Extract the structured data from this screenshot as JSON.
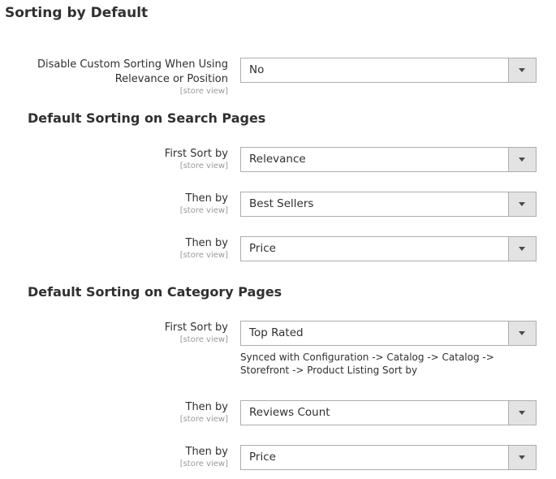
{
  "page_title": "Sorting by Default",
  "scope_label": "[store view]",
  "general": {
    "disable_custom_sorting": {
      "label": "Disable Custom Sorting When Using Relevance or Position",
      "label_line1": "Disable Custom Sorting When Using",
      "label_line2": "Relevance or Position",
      "value": "No"
    }
  },
  "search_pages": {
    "title": "Default Sorting on Search Pages",
    "fields": [
      {
        "label": "First Sort by",
        "value": "Relevance"
      },
      {
        "label": "Then by",
        "value": "Best Sellers"
      },
      {
        "label": "Then by",
        "value": "Price"
      }
    ]
  },
  "category_pages": {
    "title": "Default Sorting on Category Pages",
    "fields": [
      {
        "label": "First Sort by",
        "value": "Top Rated",
        "note": "Synced with Configuration -> Catalog -> Catalog -> Storefront -> Product Listing Sort by"
      },
      {
        "label": "Then by",
        "value": "Reviews Count"
      },
      {
        "label": "Then by",
        "value": "Price"
      }
    ]
  },
  "icons": {
    "dropdown": "chevron-down-icon"
  }
}
